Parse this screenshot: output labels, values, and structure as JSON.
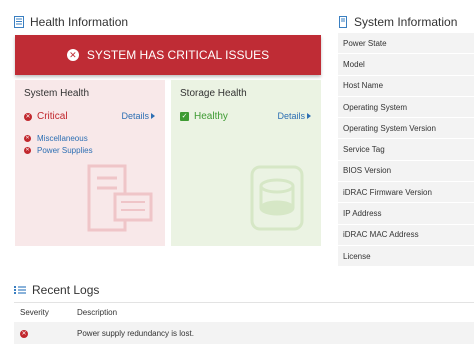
{
  "health": {
    "title": "Health Information",
    "banner": "SYSTEM HAS CRITICAL ISSUES",
    "system_health": {
      "title": "System Health",
      "status": "Critical",
      "details_link": "Details",
      "issues": [
        "Miscellaneous",
        "Power Supplies"
      ]
    },
    "storage_health": {
      "title": "Storage Health",
      "status": "Healthy",
      "details_link": "Details"
    }
  },
  "system_info": {
    "title": "System Information",
    "rows": [
      "Power State",
      "Model",
      "Host Name",
      "Operating System",
      "Operating System Version",
      "Service Tag",
      "BIOS Version",
      "iDRAC Firmware Version",
      "IP Address",
      "iDRAC MAC Address",
      "License"
    ]
  },
  "recent_logs": {
    "title": "Recent Logs",
    "columns": [
      "Severity",
      "Description"
    ],
    "rows": [
      {
        "severity": "critical",
        "description": "Power supply redundancy is lost."
      }
    ]
  },
  "colors": {
    "critical": "#c1272d",
    "banner": "#bf2c35",
    "healthy": "#3e9b33",
    "link": "#2d6fb3",
    "accent": "#3a7fc1"
  }
}
